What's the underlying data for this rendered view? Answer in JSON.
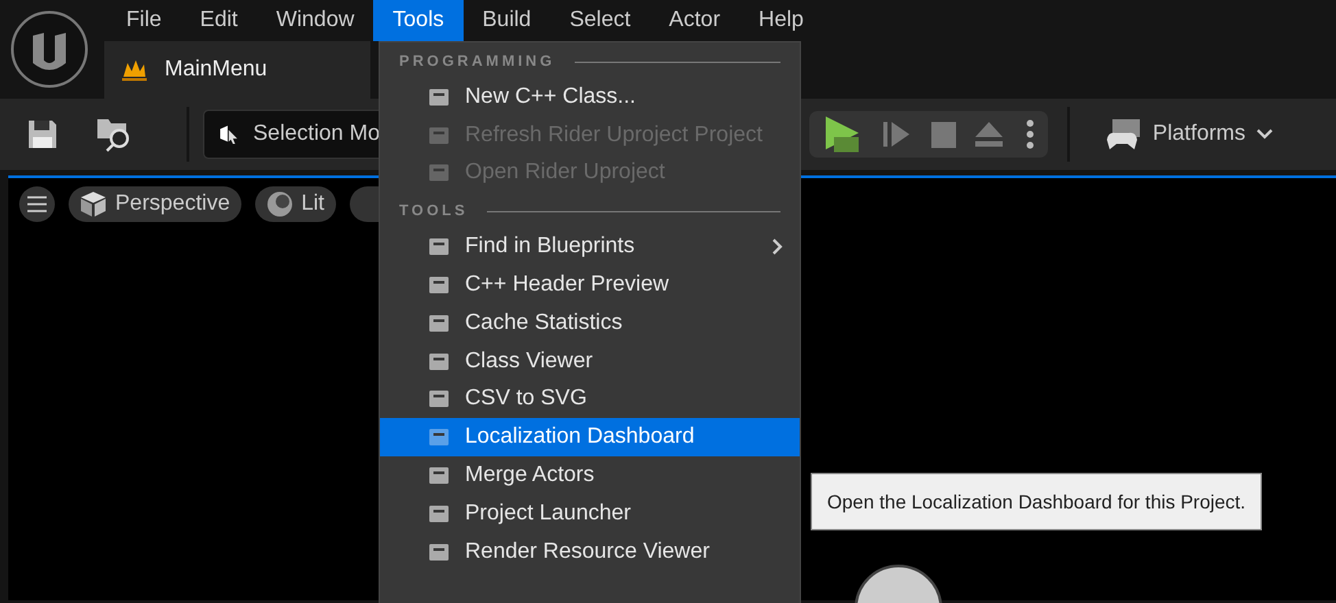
{
  "menu_bar": [
    {
      "label": "File",
      "selected": false
    },
    {
      "label": "Edit",
      "selected": false
    },
    {
      "label": "Window",
      "selected": false
    },
    {
      "label": "Tools",
      "selected": true
    },
    {
      "label": "Build",
      "selected": false
    },
    {
      "label": "Select",
      "selected": false
    },
    {
      "label": "Actor",
      "selected": false
    },
    {
      "label": "Help",
      "selected": false
    }
  ],
  "tab": {
    "title": "MainMenu"
  },
  "toolbar": {
    "mode_dropdown": "Selection Mo",
    "platforms": "Platforms"
  },
  "viewport": {
    "view_mode": "Perspective",
    "lighting": "Lit"
  },
  "tools_menu": {
    "sections": [
      {
        "header": "PROGRAMMING",
        "items": [
          {
            "label": "New C++ Class...",
            "disabled": false,
            "selected": false,
            "submenu": false
          },
          {
            "label": "Refresh Rider Uproject Project",
            "disabled": true,
            "selected": false,
            "submenu": false
          },
          {
            "label": "Open Rider Uproject",
            "disabled": true,
            "selected": false,
            "submenu": false
          }
        ]
      },
      {
        "header": "TOOLS",
        "items": [
          {
            "label": "Find in Blueprints",
            "disabled": false,
            "selected": false,
            "submenu": true
          },
          {
            "label": "C++ Header Preview",
            "disabled": false,
            "selected": false,
            "submenu": false
          },
          {
            "label": "Cache Statistics",
            "disabled": false,
            "selected": false,
            "submenu": false
          },
          {
            "label": "Class Viewer",
            "disabled": false,
            "selected": false,
            "submenu": false
          },
          {
            "label": "CSV to SVG",
            "disabled": false,
            "selected": false,
            "submenu": false
          },
          {
            "label": "Localization Dashboard",
            "disabled": false,
            "selected": true,
            "submenu": false
          },
          {
            "label": "Merge Actors",
            "disabled": false,
            "selected": false,
            "submenu": false
          },
          {
            "label": "Project Launcher",
            "disabled": false,
            "selected": false,
            "submenu": false
          },
          {
            "label": "Render Resource Viewer",
            "disabled": false,
            "selected": false,
            "submenu": false
          }
        ]
      }
    ]
  },
  "tooltip": "Open the Localization Dashboard for this Project."
}
